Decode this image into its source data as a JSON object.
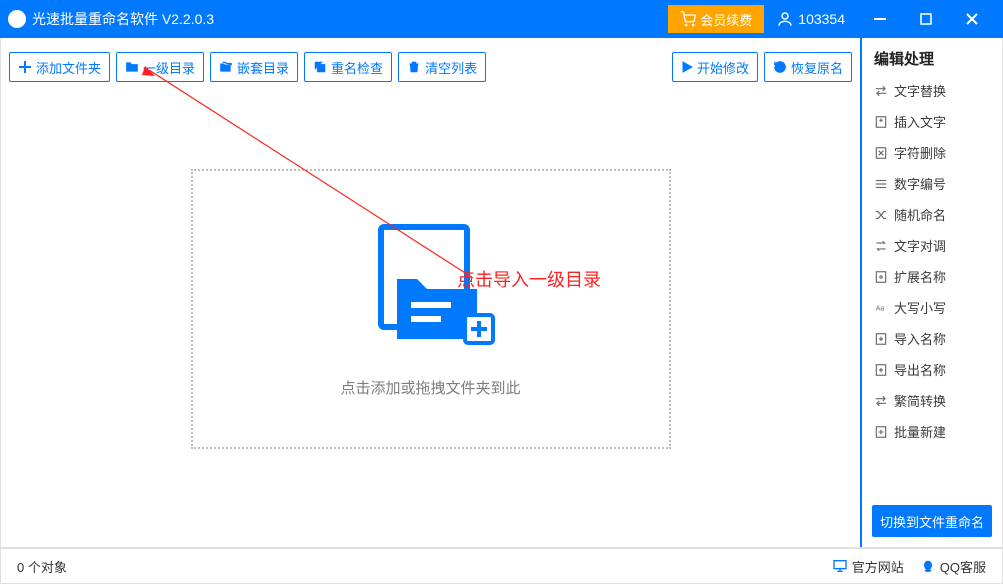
{
  "titlebar": {
    "title": "光速批量重命名软件 V2.2.0.3",
    "renew": "会员续费",
    "user_id": "103354"
  },
  "toolbar": {
    "add_folder": "添加文件夹",
    "level1_dir": "一级目录",
    "nested_dir": "嵌套目录",
    "rename_check": "重名检查",
    "clear_list": "清空列表",
    "start": "开始修改",
    "restore": "恢复原名"
  },
  "dropzone": {
    "text": "点击添加或拖拽文件夹到此"
  },
  "annotation": {
    "text": "点击导入一级目录"
  },
  "sidebar": {
    "title": "编辑处理",
    "items": [
      {
        "label": "文字替换",
        "icon": "swap-icon"
      },
      {
        "label": "插入文字",
        "icon": "insert-icon"
      },
      {
        "label": "字符删除",
        "icon": "delete-char-icon"
      },
      {
        "label": "数字编号",
        "icon": "number-icon"
      },
      {
        "label": "随机命名",
        "icon": "shuffle-icon"
      },
      {
        "label": "文字对调",
        "icon": "swap2-icon"
      },
      {
        "label": "扩展名称",
        "icon": "ext-icon"
      },
      {
        "label": "大写小写",
        "icon": "case-icon"
      },
      {
        "label": "导入名称",
        "icon": "import-icon"
      },
      {
        "label": "导出名称",
        "icon": "export-icon"
      },
      {
        "label": "繁简转换",
        "icon": "convert-icon"
      },
      {
        "label": "批量新建",
        "icon": "new-icon"
      }
    ],
    "switch_btn": "切换到文件重命名"
  },
  "statusbar": {
    "count_text": "0 个对象",
    "official_site": "官方网站",
    "qq_support": "QQ客服"
  }
}
